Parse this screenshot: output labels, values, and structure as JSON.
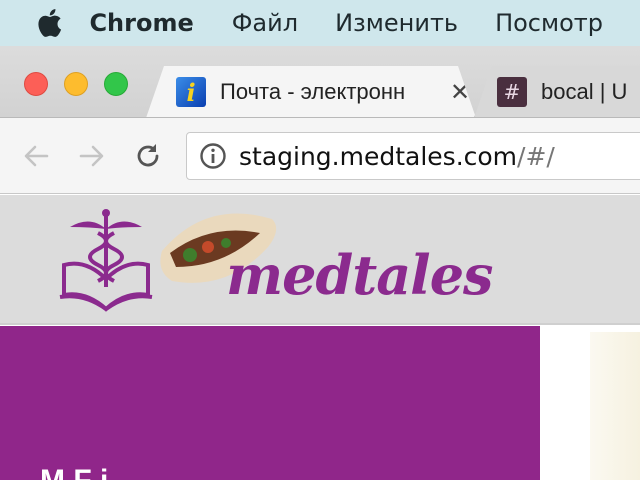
{
  "menubar": {
    "app_name": "Chrome",
    "items": [
      "Файл",
      "Изменить",
      "Посмотр"
    ]
  },
  "tabs": [
    {
      "title": "Почта - электронн",
      "favicon": "info-icon",
      "close": "✕",
      "active": true
    },
    {
      "title": "bocal | U",
      "favicon": "hash-icon",
      "active": false
    }
  ],
  "omnibox": {
    "host": "staging.medtales.com",
    "path": "/#/"
  },
  "site": {
    "logo_text": "medtales",
    "panel_text": "M  F i"
  },
  "colors": {
    "brand_purple": "#90268a",
    "menubar": "#cfe7ec"
  }
}
